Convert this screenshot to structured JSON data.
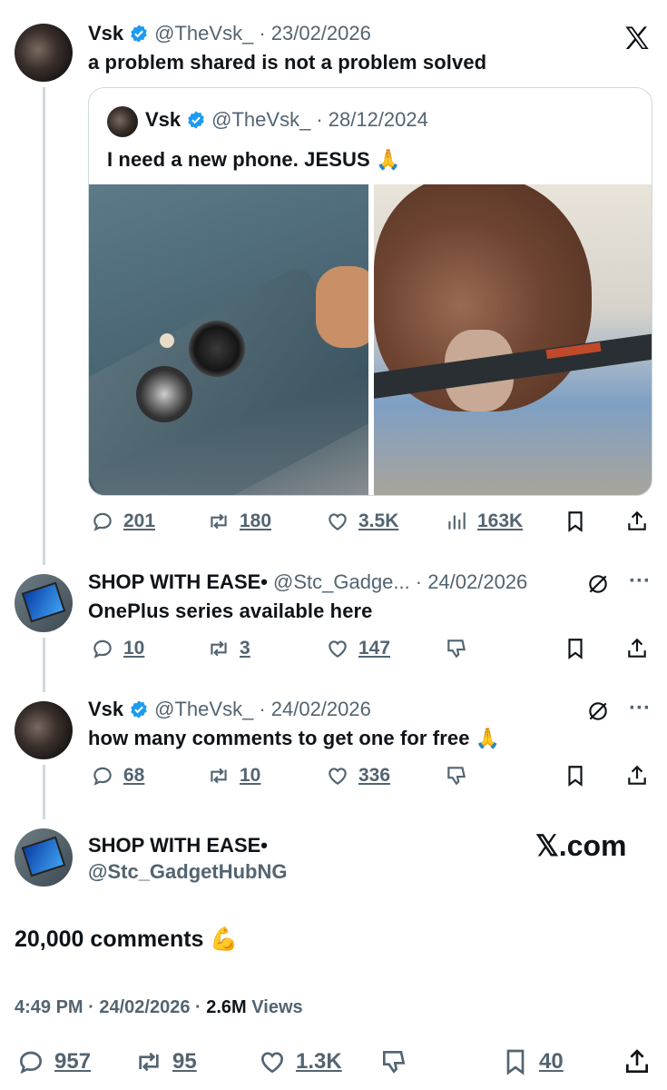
{
  "tweet1": {
    "name": "Vsk",
    "handle": "@TheVsk_",
    "date": "· 23/02/2026",
    "text": "a problem shared is not a problem solved",
    "quote": {
      "name": "Vsk",
      "handle": "@TheVsk_",
      "date": "· 28/12/2024",
      "text": "I need a new phone. JESUS 🙏"
    },
    "stats": {
      "replies": "201",
      "reposts": "180",
      "likes": "3.5K",
      "views": "163K"
    }
  },
  "reply1": {
    "name": "SHOP WITH EASE•",
    "handle": "@Stc_Gadge...",
    "date": "· 24/02/2026",
    "text": "OnePlus series available here",
    "stats": {
      "replies": "10",
      "reposts": "3",
      "likes": "147"
    }
  },
  "reply2": {
    "name": "Vsk",
    "handle": "@TheVsk_",
    "date": "· 24/02/2026",
    "text": "how many comments to get one for free 🙏",
    "stats": {
      "replies": "68",
      "reposts": "10",
      "likes": "336"
    }
  },
  "main": {
    "name": "SHOP WITH EASE•",
    "handle": "@Stc_GadgetHubNG",
    "brand": "𝕏.com",
    "text": "20,000 comments 💪",
    "time": "4:49 PM",
    "date": "· 24/02/2026 ·",
    "views_count": "2.6M",
    "views_label": "Views",
    "stats": {
      "replies": "957",
      "reposts": "95",
      "likes": "1.3K",
      "bookmarks": "40"
    }
  },
  "icons": [
    "x-logo-icon",
    "verified-badge-icon",
    "reply-icon",
    "repost-icon",
    "like-icon",
    "views-icon",
    "bookmark-icon",
    "share-icon",
    "grok-icon",
    "more-icon",
    "dislike-icon"
  ],
  "colors": {
    "verified": "#1d9bf0",
    "muted": "#536471",
    "thread_line": "#cfd9de"
  }
}
